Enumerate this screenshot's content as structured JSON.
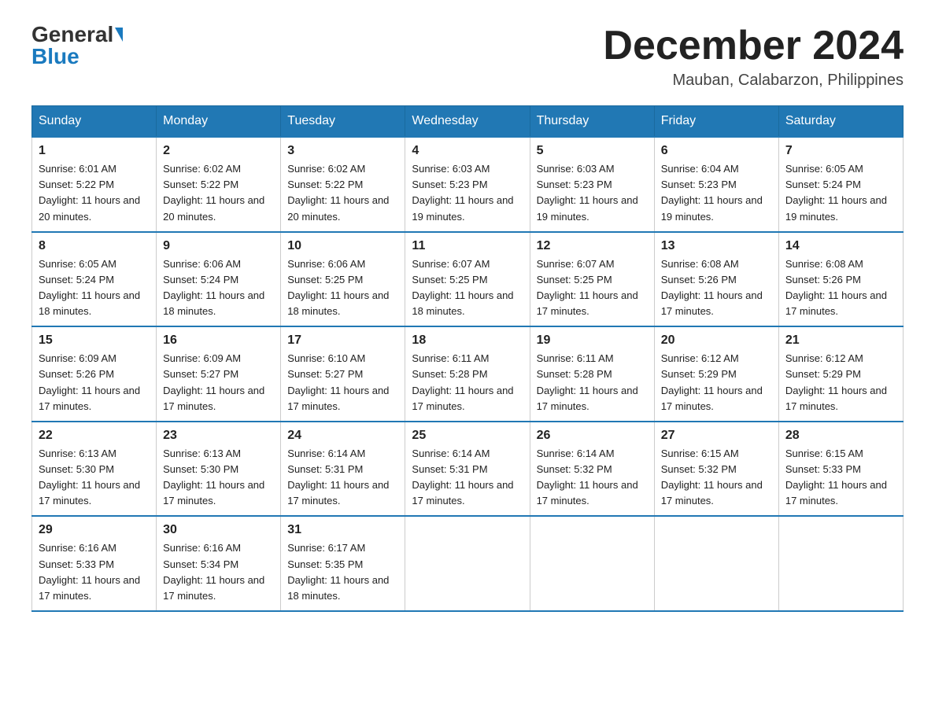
{
  "header": {
    "logo_general": "General",
    "logo_blue": "Blue",
    "month_title": "December 2024",
    "location": "Mauban, Calabarzon, Philippines"
  },
  "days_of_week": [
    "Sunday",
    "Monday",
    "Tuesday",
    "Wednesday",
    "Thursday",
    "Friday",
    "Saturday"
  ],
  "weeks": [
    [
      {
        "day": "1",
        "sunrise": "6:01 AM",
        "sunset": "5:22 PM",
        "daylight": "11 hours and 20 minutes."
      },
      {
        "day": "2",
        "sunrise": "6:02 AM",
        "sunset": "5:22 PM",
        "daylight": "11 hours and 20 minutes."
      },
      {
        "day": "3",
        "sunrise": "6:02 AM",
        "sunset": "5:22 PM",
        "daylight": "11 hours and 20 minutes."
      },
      {
        "day": "4",
        "sunrise": "6:03 AM",
        "sunset": "5:23 PM",
        "daylight": "11 hours and 19 minutes."
      },
      {
        "day": "5",
        "sunrise": "6:03 AM",
        "sunset": "5:23 PM",
        "daylight": "11 hours and 19 minutes."
      },
      {
        "day": "6",
        "sunrise": "6:04 AM",
        "sunset": "5:23 PM",
        "daylight": "11 hours and 19 minutes."
      },
      {
        "day": "7",
        "sunrise": "6:05 AM",
        "sunset": "5:24 PM",
        "daylight": "11 hours and 19 minutes."
      }
    ],
    [
      {
        "day": "8",
        "sunrise": "6:05 AM",
        "sunset": "5:24 PM",
        "daylight": "11 hours and 18 minutes."
      },
      {
        "day": "9",
        "sunrise": "6:06 AM",
        "sunset": "5:24 PM",
        "daylight": "11 hours and 18 minutes."
      },
      {
        "day": "10",
        "sunrise": "6:06 AM",
        "sunset": "5:25 PM",
        "daylight": "11 hours and 18 minutes."
      },
      {
        "day": "11",
        "sunrise": "6:07 AM",
        "sunset": "5:25 PM",
        "daylight": "11 hours and 18 minutes."
      },
      {
        "day": "12",
        "sunrise": "6:07 AM",
        "sunset": "5:25 PM",
        "daylight": "11 hours and 17 minutes."
      },
      {
        "day": "13",
        "sunrise": "6:08 AM",
        "sunset": "5:26 PM",
        "daylight": "11 hours and 17 minutes."
      },
      {
        "day": "14",
        "sunrise": "6:08 AM",
        "sunset": "5:26 PM",
        "daylight": "11 hours and 17 minutes."
      }
    ],
    [
      {
        "day": "15",
        "sunrise": "6:09 AM",
        "sunset": "5:26 PM",
        "daylight": "11 hours and 17 minutes."
      },
      {
        "day": "16",
        "sunrise": "6:09 AM",
        "sunset": "5:27 PM",
        "daylight": "11 hours and 17 minutes."
      },
      {
        "day": "17",
        "sunrise": "6:10 AM",
        "sunset": "5:27 PM",
        "daylight": "11 hours and 17 minutes."
      },
      {
        "day": "18",
        "sunrise": "6:11 AM",
        "sunset": "5:28 PM",
        "daylight": "11 hours and 17 minutes."
      },
      {
        "day": "19",
        "sunrise": "6:11 AM",
        "sunset": "5:28 PM",
        "daylight": "11 hours and 17 minutes."
      },
      {
        "day": "20",
        "sunrise": "6:12 AM",
        "sunset": "5:29 PM",
        "daylight": "11 hours and 17 minutes."
      },
      {
        "day": "21",
        "sunrise": "6:12 AM",
        "sunset": "5:29 PM",
        "daylight": "11 hours and 17 minutes."
      }
    ],
    [
      {
        "day": "22",
        "sunrise": "6:13 AM",
        "sunset": "5:30 PM",
        "daylight": "11 hours and 17 minutes."
      },
      {
        "day": "23",
        "sunrise": "6:13 AM",
        "sunset": "5:30 PM",
        "daylight": "11 hours and 17 minutes."
      },
      {
        "day": "24",
        "sunrise": "6:14 AM",
        "sunset": "5:31 PM",
        "daylight": "11 hours and 17 minutes."
      },
      {
        "day": "25",
        "sunrise": "6:14 AM",
        "sunset": "5:31 PM",
        "daylight": "11 hours and 17 minutes."
      },
      {
        "day": "26",
        "sunrise": "6:14 AM",
        "sunset": "5:32 PM",
        "daylight": "11 hours and 17 minutes."
      },
      {
        "day": "27",
        "sunrise": "6:15 AM",
        "sunset": "5:32 PM",
        "daylight": "11 hours and 17 minutes."
      },
      {
        "day": "28",
        "sunrise": "6:15 AM",
        "sunset": "5:33 PM",
        "daylight": "11 hours and 17 minutes."
      }
    ],
    [
      {
        "day": "29",
        "sunrise": "6:16 AM",
        "sunset": "5:33 PM",
        "daylight": "11 hours and 17 minutes."
      },
      {
        "day": "30",
        "sunrise": "6:16 AM",
        "sunset": "5:34 PM",
        "daylight": "11 hours and 17 minutes."
      },
      {
        "day": "31",
        "sunrise": "6:17 AM",
        "sunset": "5:35 PM",
        "daylight": "11 hours and 18 minutes."
      },
      null,
      null,
      null,
      null
    ]
  ],
  "labels": {
    "sunrise": "Sunrise:",
    "sunset": "Sunset:",
    "daylight": "Daylight:"
  }
}
